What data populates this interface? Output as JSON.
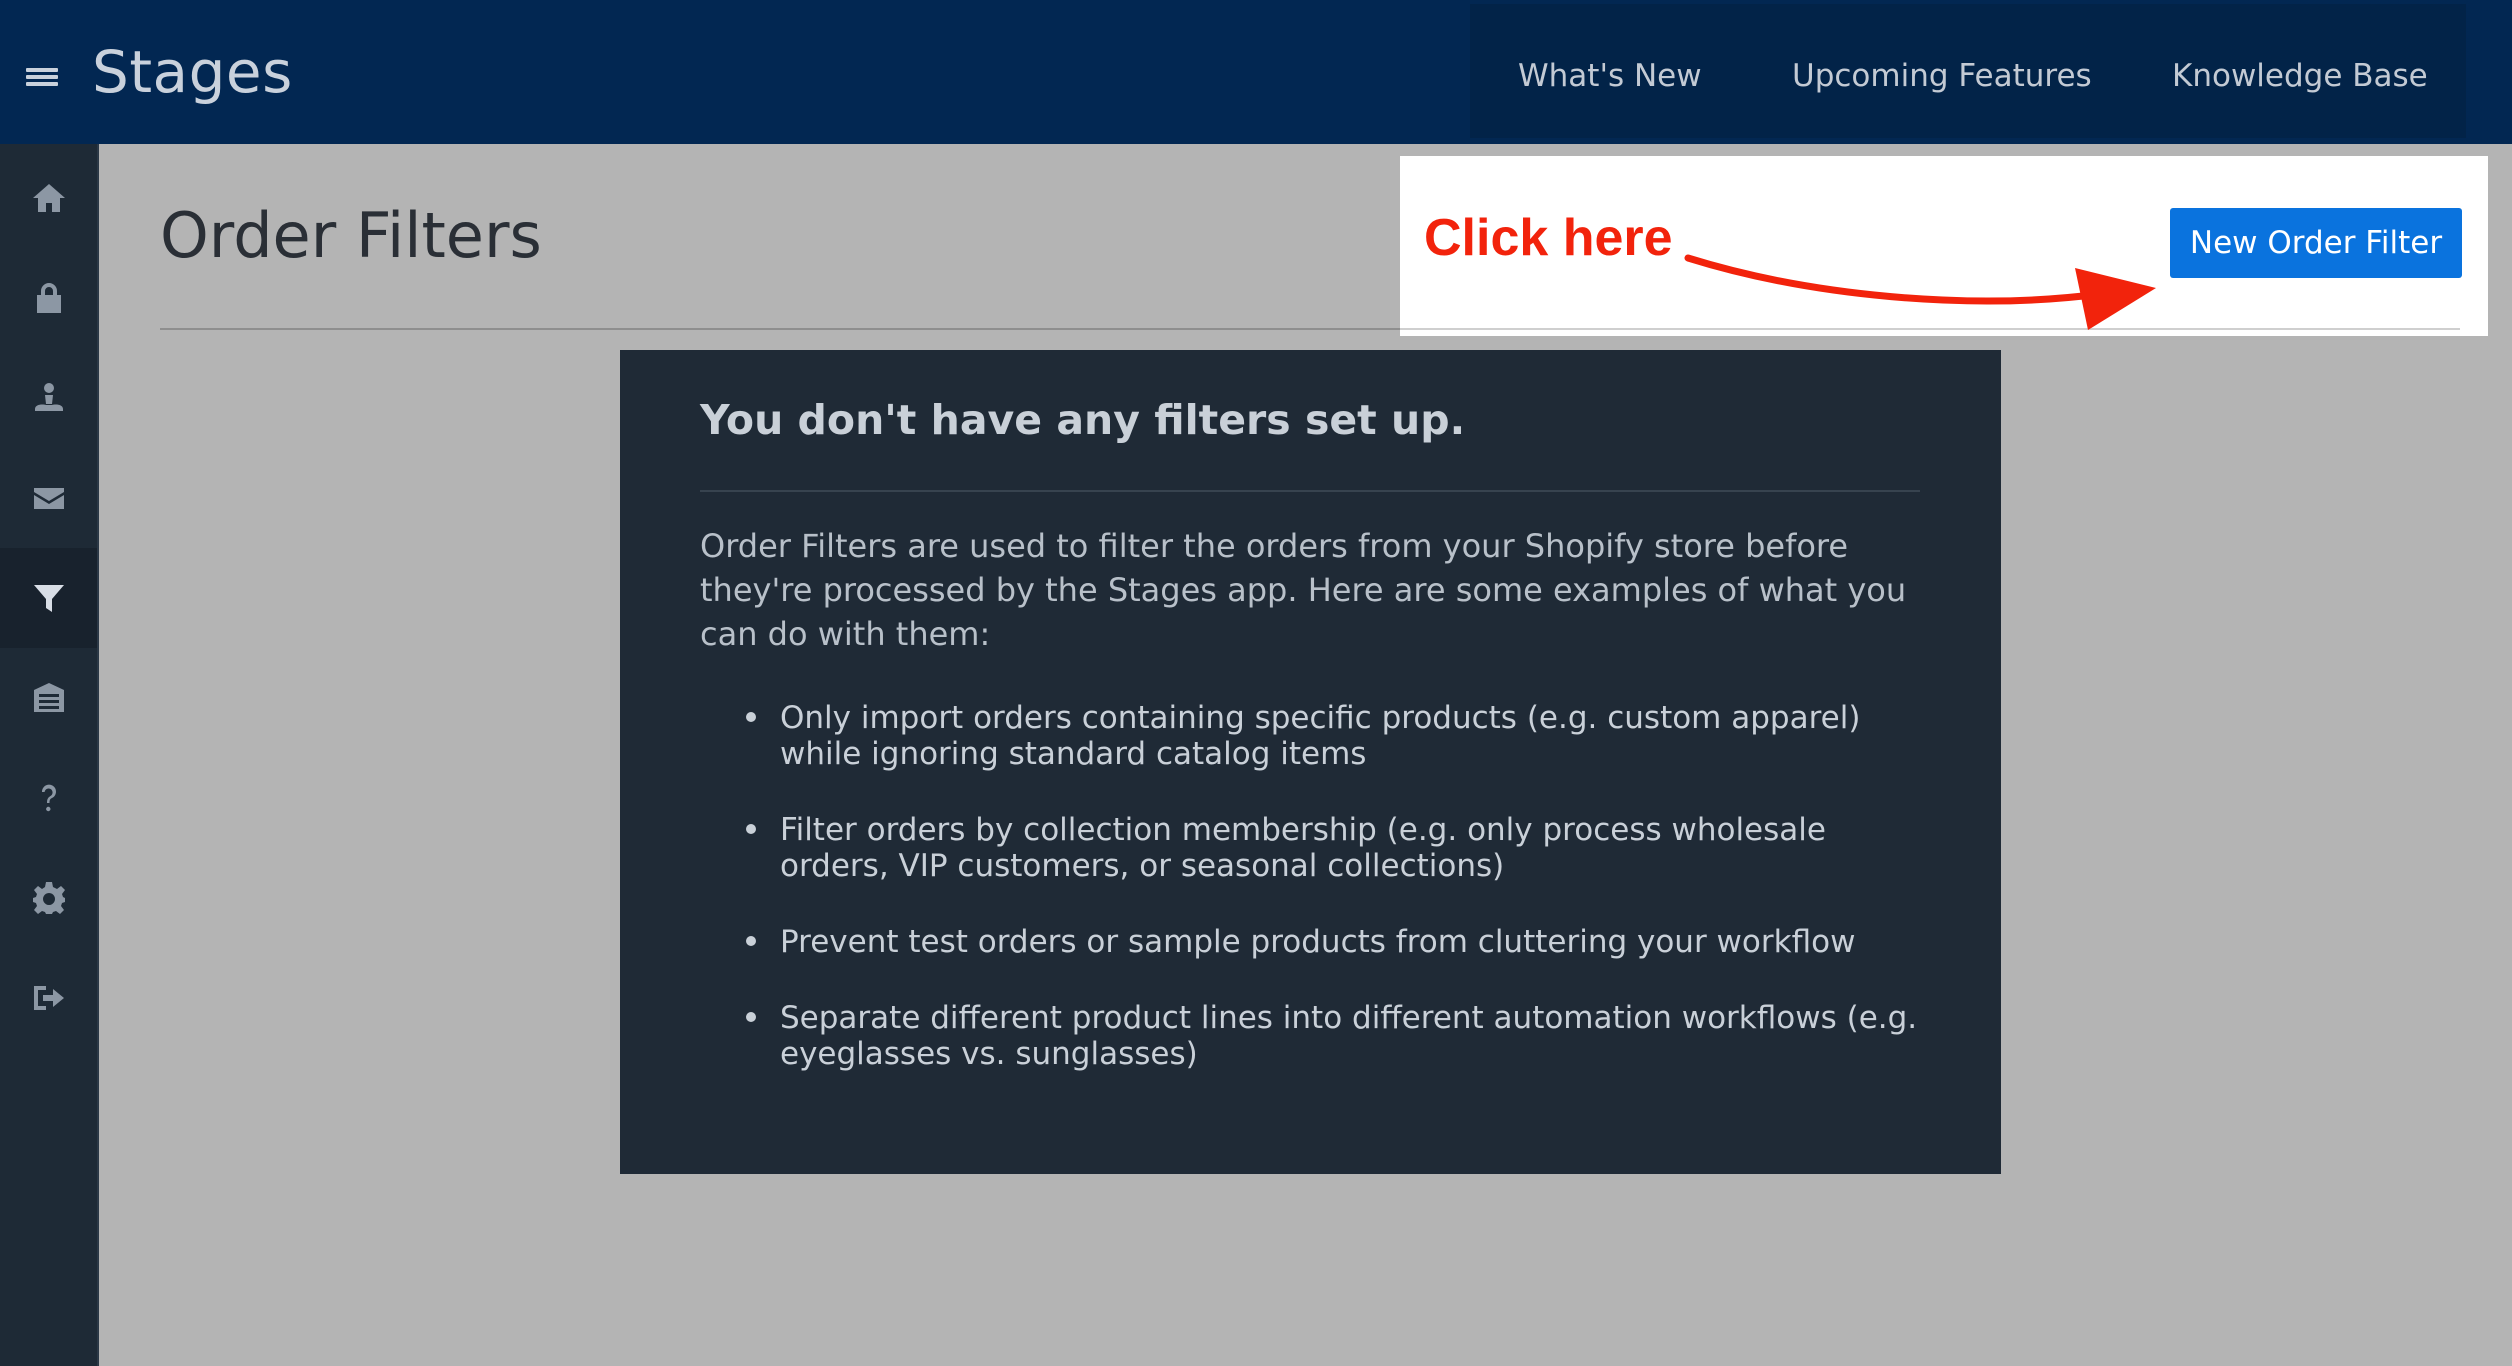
{
  "app": {
    "title": "Stages"
  },
  "topnav": {
    "items": [
      {
        "label": "What's New"
      },
      {
        "label": "Upcoming Features"
      },
      {
        "label": "Knowledge Base"
      }
    ]
  },
  "sidebar": {
    "items": [
      {
        "icon": "home-icon",
        "active": false
      },
      {
        "icon": "lock-icon",
        "active": false
      },
      {
        "icon": "user-icon",
        "active": false
      },
      {
        "icon": "envelope-icon",
        "active": false
      },
      {
        "icon": "filter-icon",
        "active": true
      },
      {
        "icon": "archive-icon",
        "active": false
      },
      {
        "icon": "question-icon",
        "active": false
      },
      {
        "icon": "gear-icon",
        "active": false
      },
      {
        "icon": "sign-out-icon",
        "active": false
      }
    ]
  },
  "page": {
    "title": "Order Filters"
  },
  "callout": {
    "text": "Click here",
    "color": "#f2230c",
    "button_label": "New Order Filter",
    "button_color": "#0a73de"
  },
  "empty_state": {
    "heading": "You don't have any filters set up.",
    "intro": "Order Filters are used to filter the orders from your Shopify store before they're processed by the Stages app. Here are some examples of what you can do with them:",
    "examples": [
      "Only import orders containing specific products (e.g. custom apparel) while ignoring standard catalog items",
      "Filter orders by collection membership (e.g. only process wholesale orders, VIP customers, or seasonal collections)",
      "Prevent test orders or sample products from cluttering your workflow",
      "Separate different product lines into different automation workflows (e.g. eyeglasses vs. sunglasses)"
    ]
  },
  "colors": {
    "header_bg": "#022752",
    "sidebar_bg": "#1e2a36",
    "content_bg": "#b4b4b4",
    "panel_bg": "#1f2a36"
  }
}
